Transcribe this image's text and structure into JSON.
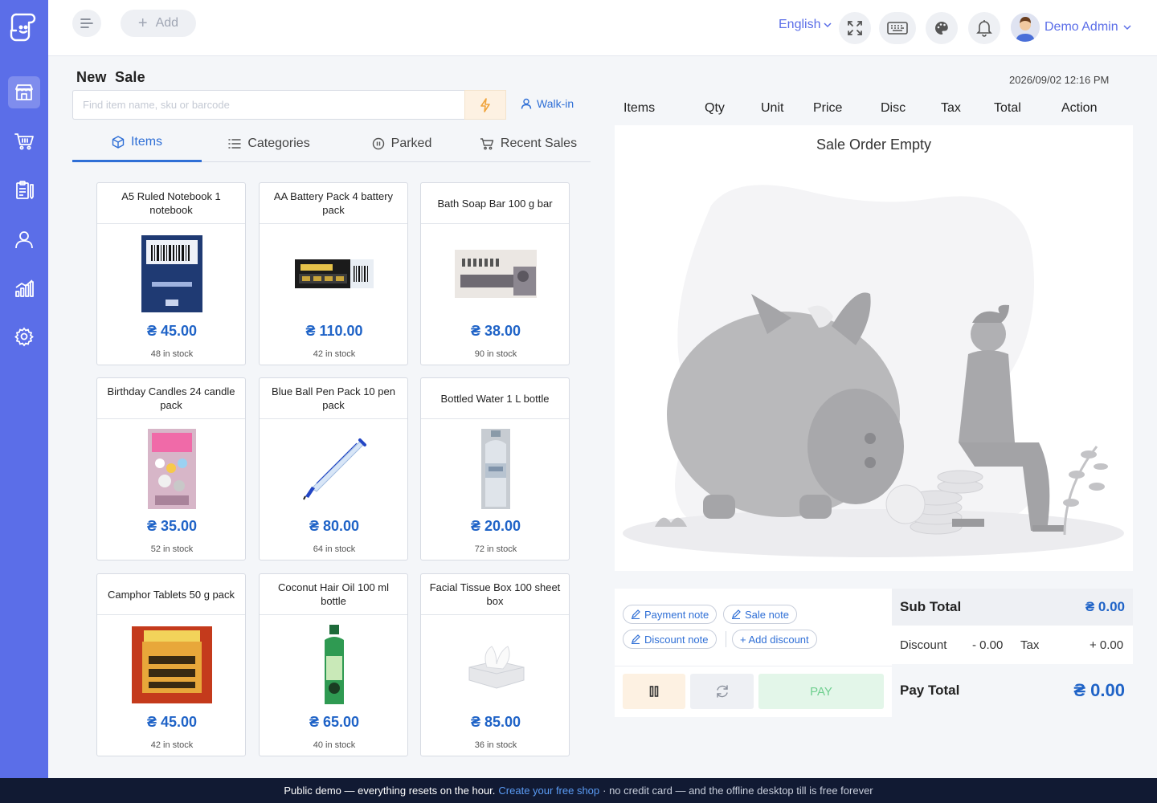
{
  "topbar": {
    "add_label": "Add",
    "language": "English",
    "user_name": "Demo Admin"
  },
  "page": {
    "title": "New  Sale",
    "datetime": "2026/09/02 12:16 PM"
  },
  "search": {
    "placeholder": "Find item name, sku or barcode",
    "customer": "Walk-in"
  },
  "tabs": [
    "Items",
    "Categories",
    "Parked",
    "Recent Sales"
  ],
  "products": [
    {
      "name": "A5 Ruled Notebook 1 notebook",
      "price": "₴ 45.00",
      "stock": "48 in stock"
    },
    {
      "name": "AA Battery Pack 4 battery pack",
      "price": "₴ 110.00",
      "stock": "42 in stock"
    },
    {
      "name": "Bath Soap Bar 100 g bar",
      "price": "₴ 38.00",
      "stock": "90 in stock"
    },
    {
      "name": "Birthday Candles 24 candle pack",
      "price": "₴ 35.00",
      "stock": "52 in stock"
    },
    {
      "name": "Blue Ball Pen Pack 10 pen pack",
      "price": "₴ 80.00",
      "stock": "64 in stock"
    },
    {
      "name": "Bottled Water 1 L bottle",
      "price": "₴ 20.00",
      "stock": "72 in stock"
    },
    {
      "name": "Camphor Tablets 50 g pack",
      "price": "₴ 45.00",
      "stock": "42 in stock"
    },
    {
      "name": "Coconut Hair Oil 100 ml bottle",
      "price": "₴ 65.00",
      "stock": "40 in stock"
    },
    {
      "name": "Facial Tissue Box 100 sheet box",
      "price": "₴ 85.00",
      "stock": "36 in stock"
    }
  ],
  "order": {
    "columns": [
      "Items",
      "Qty",
      "Unit",
      "Price",
      "Disc",
      "Tax",
      "Total",
      "Action"
    ],
    "empty_text": "Sale Order Empty"
  },
  "notes": {
    "payment_note": "Payment note",
    "sale_note": "Sale note",
    "discount_note": "Discount note",
    "add_discount": "+ Add discount"
  },
  "actions": {
    "pay_label": "PAY"
  },
  "totals": {
    "sub_total_label": "Sub Total",
    "sub_total_value": "₴ 0.00",
    "discount_label": "Discount",
    "discount_value": "- 0.00",
    "tax_label": "Tax",
    "tax_value": "+ 0.00",
    "pay_total_label": "Pay Total",
    "pay_total_value": "₴ 0.00"
  },
  "footer": {
    "part1": "Public demo — everything resets on the hour.",
    "link": "Create your free shop",
    "part2": "· no credit card — and the offline desktop till is free forever"
  },
  "colors": {
    "sidebar": "#5b6ee8",
    "accent": "#1f63c7",
    "footer": "#111a33"
  }
}
